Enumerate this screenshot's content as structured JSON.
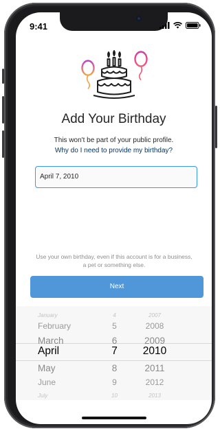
{
  "status_bar": {
    "time": "9:41"
  },
  "header": {
    "title": "Add Your Birthday",
    "subtitle": "This won't be part of your public profile.",
    "help_link": "Why do I need to provide my birthday?"
  },
  "birthday_input": {
    "value": "April 7, 2010"
  },
  "footer_note": {
    "line1": "Use your own birthday, even if this account is for a business,",
    "line2": "a pet or something else."
  },
  "next_button": {
    "label": "Next",
    "color": "#4f97d9"
  },
  "picker": {
    "months": [
      "January",
      "February",
      "March",
      "April",
      "May",
      "June",
      "July"
    ],
    "days": [
      "4",
      "5",
      "6",
      "7",
      "8",
      "9",
      "10"
    ],
    "years": [
      "2007",
      "2008",
      "2009",
      "2010",
      "2011",
      "2012",
      "2013"
    ],
    "selected_index": 3
  },
  "colors": {
    "link": "#003569",
    "accent": "#3897f0"
  }
}
